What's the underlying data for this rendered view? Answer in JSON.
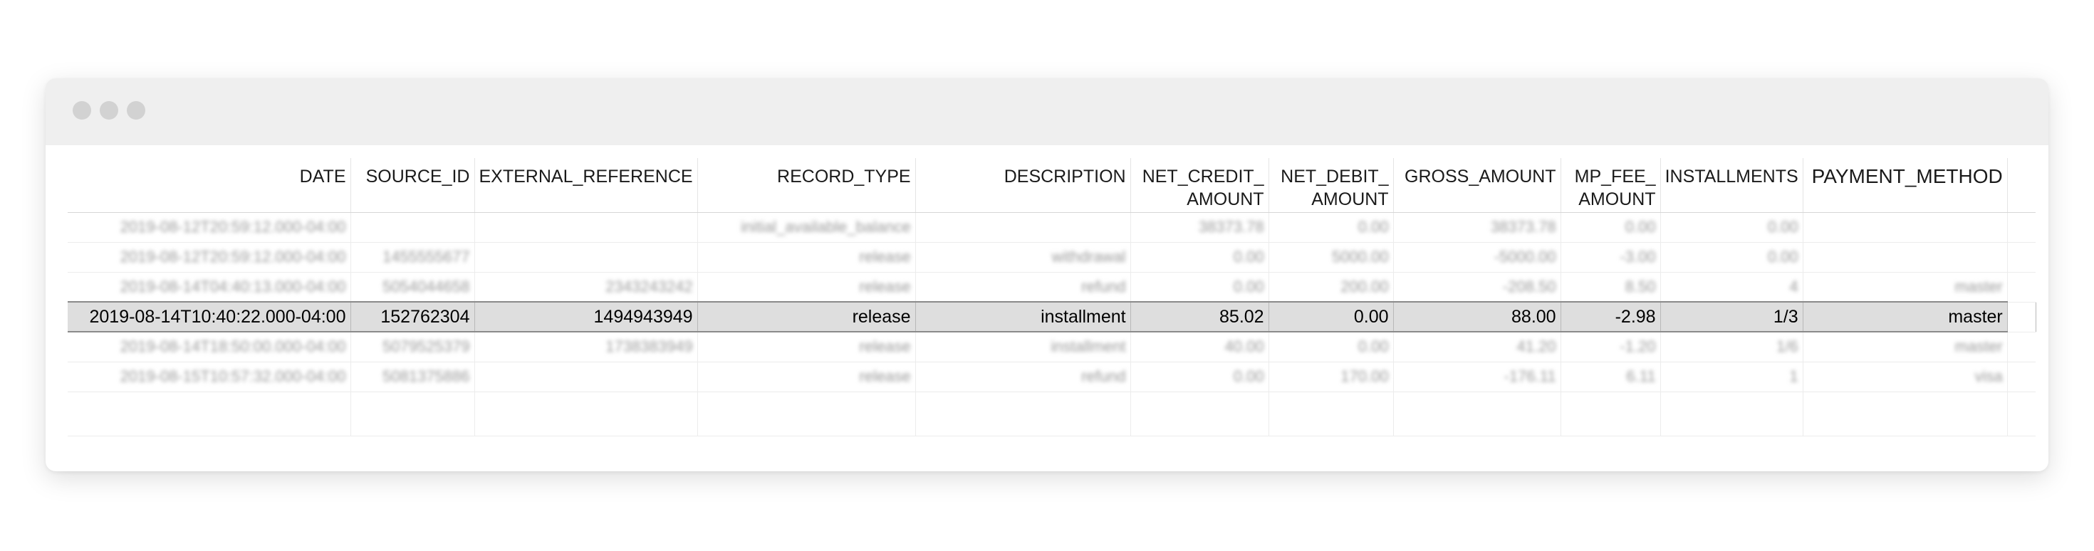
{
  "window": {
    "controls": [
      "close-dot",
      "minimize-dot",
      "zoom-dot"
    ]
  },
  "table": {
    "headers": [
      {
        "line1": "DATE",
        "line2": ""
      },
      {
        "line1": "SOURCE_ID",
        "line2": ""
      },
      {
        "line1": "EXTERNAL_REFERENCE",
        "line2": ""
      },
      {
        "line1": "RECORD_TYPE",
        "line2": ""
      },
      {
        "line1": "DESCRIPTION",
        "line2": ""
      },
      {
        "line1": "NET_CREDIT_",
        "line2": "AMOUNT"
      },
      {
        "line1": "NET_DEBIT_",
        "line2": "AMOUNT"
      },
      {
        "line1": "GROSS_AMOUNT",
        "line2": ""
      },
      {
        "line1": "MP_FEE_",
        "line2": "AMOUNT"
      },
      {
        "line1": "INSTALLMENTS",
        "line2": ""
      },
      {
        "line1": "PAYMENT_METHOD",
        "line2": ""
      }
    ],
    "rows": [
      {
        "cells": [
          "2019-08-12T20:59:12.000-04:00",
          "",
          "",
          "initial_available_balance",
          "",
          "38373.78",
          "0.00",
          "38373.78",
          "0.00",
          "0.00",
          ""
        ],
        "highlighted": false
      },
      {
        "cells": [
          "2019-08-12T20:59:12.000-04:00",
          "1455555677",
          "",
          "release",
          "withdrawal",
          "0.00",
          "5000.00",
          "-5000.00",
          "-3.00",
          "0.00",
          ""
        ],
        "highlighted": false
      },
      {
        "cells": [
          "2019-08-14T04:40:13.000-04:00",
          "5054044658",
          "2343243242",
          "release",
          "refund",
          "0.00",
          "200.00",
          "-208.50",
          "8.50",
          "4",
          "master"
        ],
        "highlighted": false
      },
      {
        "cells": [
          "2019-08-14T10:40:22.000-04:00",
          "152762304",
          "1494943949",
          "release",
          "installment",
          "85.02",
          "0.00",
          "88.00",
          "-2.98",
          "1/3",
          "master"
        ],
        "highlighted": true
      },
      {
        "cells": [
          "2019-08-14T18:50:00.000-04:00",
          "5079525379",
          "1738383949",
          "release",
          "installment",
          "40.00",
          "0.00",
          "41.20",
          "-1.20",
          "1/6",
          "master"
        ],
        "highlighted": false
      },
      {
        "cells": [
          "2019-08-15T10:57:32.000-04:00",
          "5081375886",
          "",
          "release",
          "refund",
          "0.00",
          "170.00",
          "-176.11",
          "6.11",
          "1",
          "visa"
        ],
        "highlighted": false
      }
    ]
  }
}
